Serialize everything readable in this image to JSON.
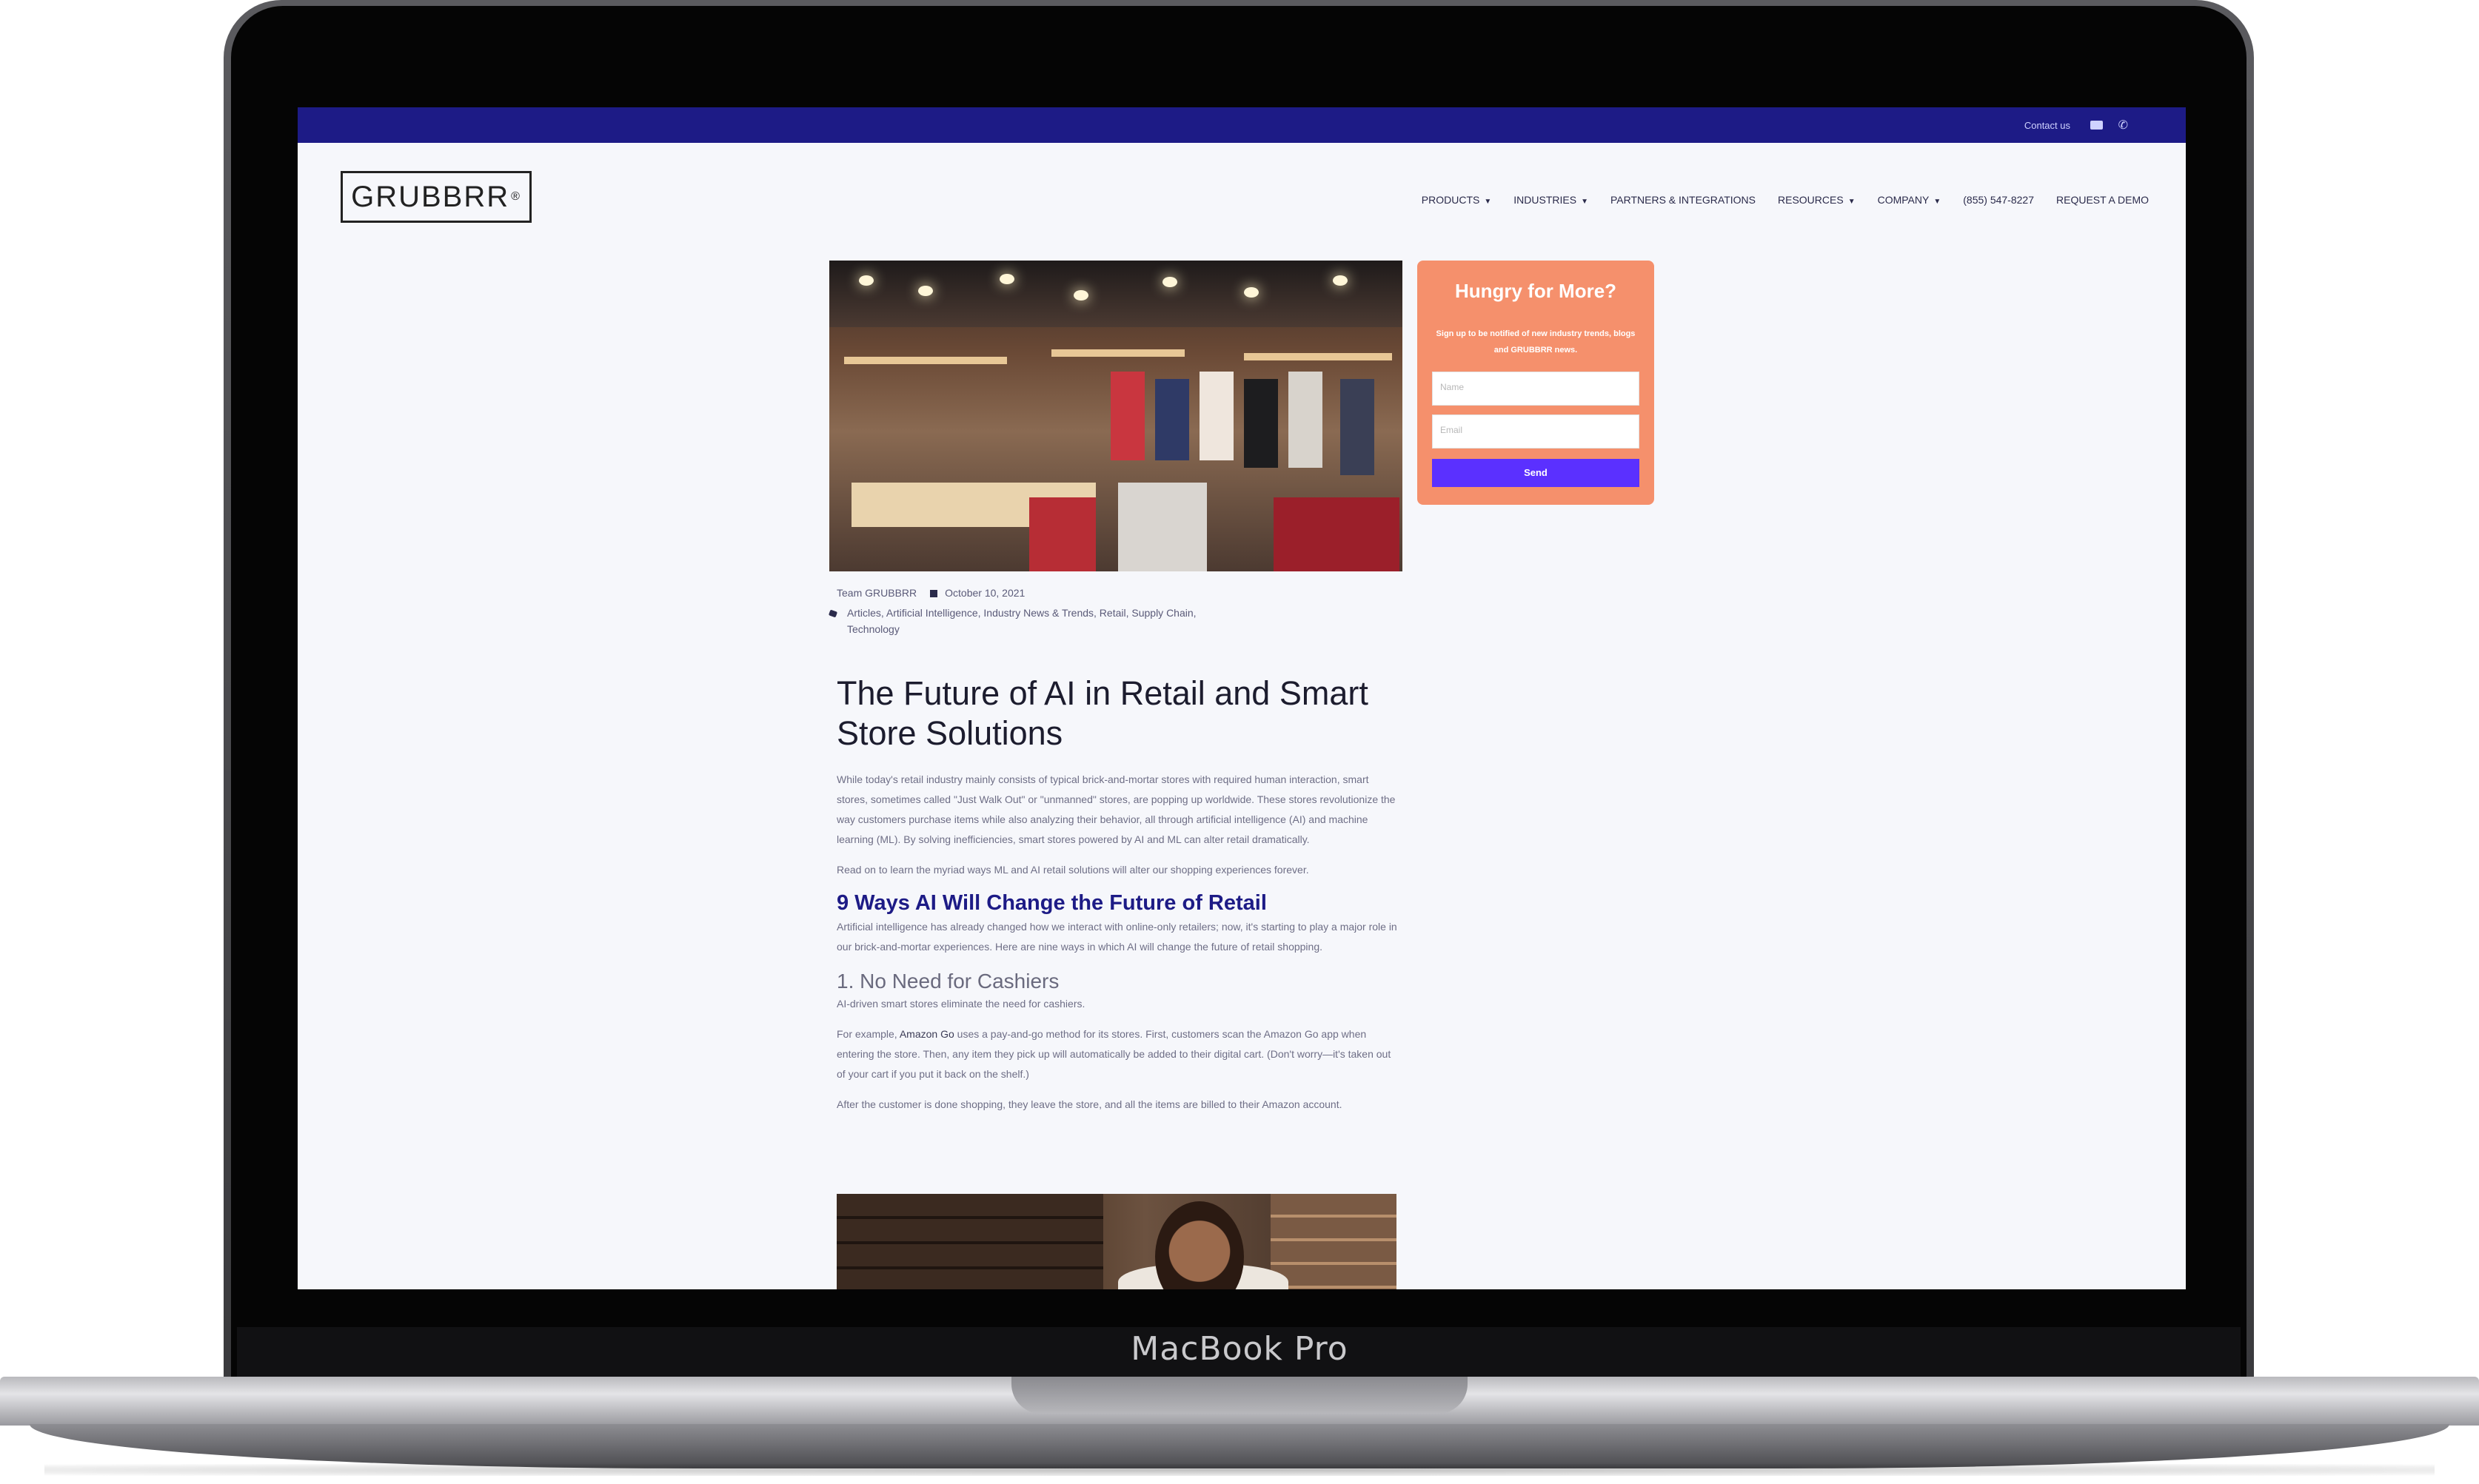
{
  "device": {
    "label": "MacBook Pro"
  },
  "topbar": {
    "contact_label": "Contact us"
  },
  "logo": {
    "text": "GRUBBRR",
    "mark": "®"
  },
  "nav": {
    "items": [
      {
        "label": "PRODUCTS",
        "dropdown": true
      },
      {
        "label": "INDUSTRIES",
        "dropdown": true
      },
      {
        "label": "PARTNERS & INTEGRATIONS",
        "dropdown": false
      },
      {
        "label": "RESOURCES",
        "dropdown": true
      },
      {
        "label": "COMPANY",
        "dropdown": true
      },
      {
        "label": "(855) 547-8227",
        "dropdown": false
      },
      {
        "label": "REQUEST A DEMO",
        "dropdown": false
      }
    ]
  },
  "signup": {
    "title": "Hungry for More?",
    "text": "Sign up to be notified of new industry trends, blogs and GRUBBRR news.",
    "name_placeholder": "Name",
    "email_placeholder": "Email",
    "button_label": "Send",
    "background_color": "#f5906c",
    "button_color": "#5b30ff"
  },
  "post": {
    "author": "Team GRUBBRR",
    "date": "October 10, 2021",
    "categories": "Articles, Artificial Intelligence, Industry News & Trends, Retail, Supply Chain, Technology",
    "title": "The Future of AI in Retail and Smart Store Solutions",
    "intro": "While today's retail industry mainly consists of typical brick-and-mortar stores with required human interaction, smart stores, sometimes called \"Just Walk Out\" or \"unmanned\" stores, are popping up worldwide. These stores revolutionize the way customers purchase items while also analyzing their behavior, all through artificial intelligence (AI) and machine learning (ML). By solving inefficiencies, smart stores powered by AI and ML can alter retail dramatically.",
    "read_on": "Read on to learn the myriad ways ML and AI retail solutions will alter our shopping experiences forever.",
    "section_heading": "9 Ways AI Will Change the Future of Retail",
    "section_text": "Artificial intelligence has already changed how we interact with online-only retailers; now, it's starting to play a major role in our brick-and-mortar experiences. Here are nine ways in which AI will change the future of retail shopping.",
    "point1_heading": "1. No Need for Cashiers",
    "point1_text": "AI-driven smart stores eliminate the need for cashiers.",
    "example_prefix": "For example, ",
    "example_link": "Amazon Go",
    "example_rest": " uses a pay-and-go method for its stores. First, customers scan the Amazon Go app when entering the store. Then, any item they pick up will automatically be added to their digital cart. (Don't worry—it's taken out of your cart if you put it back on the shelf.)",
    "after_text": "After the customer is done shopping, they leave the store, and all the items are billed to their Amazon account."
  },
  "colors": {
    "topbar": "#1d1b86",
    "heading_link": "#1d1b86"
  }
}
